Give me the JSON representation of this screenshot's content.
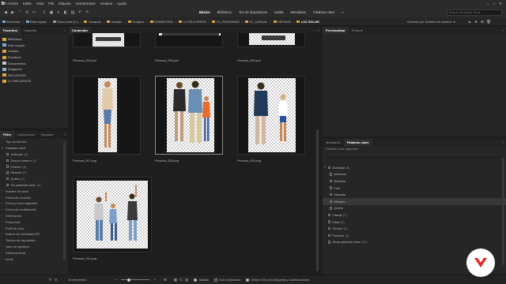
{
  "menu": [
    "Archivo",
    "Editar",
    "Vista",
    "Pila",
    "Etiqueta",
    "Herramientas",
    "Ventana",
    "Ayuda"
  ],
  "workspaces": [
    "Básico",
    "Biblioteca",
    "Tira de diapositivas",
    "Salida",
    "Metadatos",
    "Palabras clave"
  ],
  "active_workspace": "Básico",
  "search_placeholder": "Buscar en Adobe Stock",
  "breadcrumb": [
    "Escritorio",
    "Este equipo",
    "Disco local (C:)",
    "Usuarios",
    "Usuario",
    "Dropbox",
    "DOMESTIKA",
    "3.1.RECURSOS",
    "01_PERSONAS",
    "01_CASUAL",
    "VERANO",
    "LUZ SOLAR"
  ],
  "sort_label": "Ordenar por Nombre de archivo",
  "left_top_tabs": [
    "Favoritos",
    "Carpetas"
  ],
  "favorites": [
    {
      "label": "Biblioteca",
      "icon": "folder"
    },
    {
      "label": "Este equipo",
      "icon": "pc"
    },
    {
      "label": "Usuario",
      "icon": "folder"
    },
    {
      "label": "Escritorio",
      "icon": "folder"
    },
    {
      "label": "Documentos",
      "icon": "doc"
    },
    {
      "label": "Imágenes",
      "icon": "img"
    },
    {
      "label": "RECURSOS",
      "icon": "folder"
    },
    {
      "label": "3.1.RECURSOS",
      "icon": "folder"
    }
  ],
  "left_bottom_tabs": [
    "Filtro",
    "Colecciones",
    "Exportar"
  ],
  "filters": [
    {
      "label": "Tipo de archivo",
      "open": false
    },
    {
      "label": "Palabras clave",
      "open": true
    },
    {
      "label": "Andando",
      "count": "(4)",
      "sub": true
    },
    {
      "label": "Descon-trasero",
      "count": "(2)",
      "sub": true
    },
    {
      "label": "Exterior",
      "count": "(8)",
      "sub": true
    },
    {
      "label": "Mirando",
      "count": "(2)",
      "sub": true
    },
    {
      "label": "Quieto",
      "count": "(2)",
      "sub": true
    },
    {
      "label": "Sin palabras clave",
      "count": "(0)",
      "sub": true
    },
    {
      "label": "Nombre de autor",
      "open": false
    },
    {
      "label": "Fecha de creación",
      "open": false
    },
    {
      "label": "Fecha y hora originales",
      "open": false
    },
    {
      "label": "Fecha de modificación",
      "open": false
    },
    {
      "label": "Orientación",
      "open": false
    },
    {
      "label": "Proporción",
      "open": false
    },
    {
      "label": "Perfil de color",
      "open": false
    },
    {
      "label": "Índices de velocidad ISO",
      "open": false
    },
    {
      "label": "Tiempo de exposición",
      "open": false
    },
    {
      "label": "Valor de apertura",
      "open": false
    },
    {
      "label": "Distancia focal",
      "open": false
    },
    {
      "label": "Lente",
      "open": false
    }
  ],
  "content_tab": "Contenido",
  "files": [
    {
      "name": "Persona_004.psd"
    },
    {
      "name": "Persona_005.psd"
    },
    {
      "name": "Persona_006.psd"
    },
    {
      "name": "Persona_007.png"
    },
    {
      "name": "Persona_008.png"
    },
    {
      "name": "Persona_009.png"
    },
    {
      "name": "Persona_010.png"
    }
  ],
  "preview_tabs": [
    "Previsualizar",
    "Publicar"
  ],
  "meta_tabs": [
    "Metadatos",
    "Palabras clave"
  ],
  "keywords_caption": "Palabras clave asignadas:",
  "keywords": [
    {
      "label": "Actividad",
      "count": "(6)",
      "group": true
    },
    {
      "label": "Andando",
      "sub": true
    },
    {
      "label": "Bicicleta",
      "sub": true
    },
    {
      "label": "Foto",
      "sub": true
    },
    {
      "label": "Mascota",
      "sub": true
    },
    {
      "label": "Mirando",
      "sub": true,
      "hl": true
    },
    {
      "label": "Quieto",
      "sub": true
    },
    {
      "label": "Casual",
      "count": "(7)",
      "group": true
    },
    {
      "label": "Edad",
      "count": "(5)",
      "group": true
    },
    {
      "label": "Género",
      "count": "(3)",
      "group": true
    },
    {
      "label": "Posición",
      "count": "(3)",
      "group": true
    },
    {
      "label": "Otras palabras clave",
      "count": "(23)",
      "group": true
    }
  ],
  "status": {
    "items": "10 elementos",
    "view_options": [
      "Apilado",
      "Solo miniaturas",
      "Utilizar Ctrl para etiquetas y clasificaciones"
    ]
  },
  "colors": {
    "brand": "#e8251f",
    "folder": "#d9a441"
  }
}
